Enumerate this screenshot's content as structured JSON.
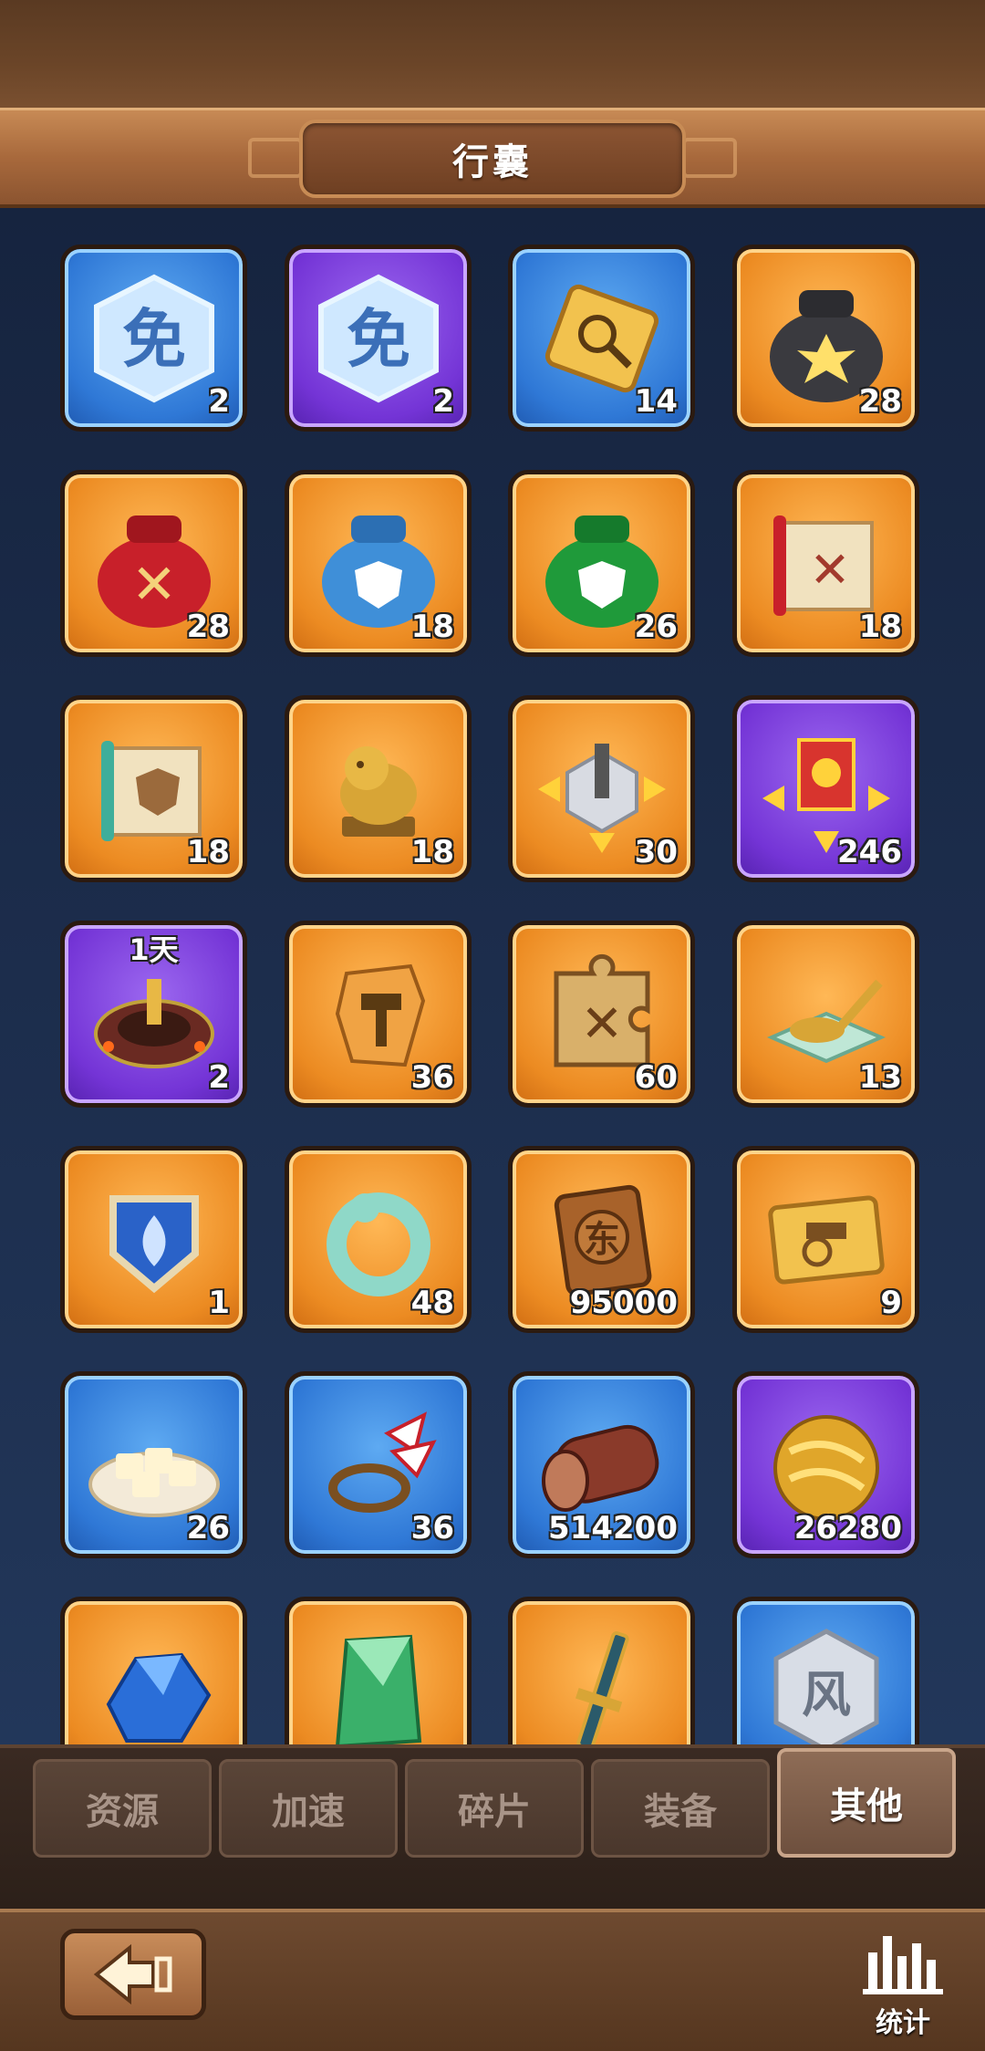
{
  "header": {
    "title": "行囊"
  },
  "items": [
    {
      "icon": "immunity-shield-icon",
      "count": "2",
      "rarity": "blue"
    },
    {
      "icon": "immunity-shield-icon",
      "count": "2",
      "rarity": "purple"
    },
    {
      "icon": "scout-token-icon",
      "count": "14",
      "rarity": "blue"
    },
    {
      "icon": "black-resource-bag-icon",
      "count": "28",
      "rarity": "orange"
    },
    {
      "icon": "red-swords-bag-icon",
      "count": "28",
      "rarity": "orange"
    },
    {
      "icon": "blue-shield-bag-icon",
      "count": "18",
      "rarity": "orange"
    },
    {
      "icon": "green-shield-bag-icon",
      "count": "26",
      "rarity": "orange"
    },
    {
      "icon": "swords-scroll-icon",
      "count": "18",
      "rarity": "orange"
    },
    {
      "icon": "shield-scroll-icon",
      "count": "18",
      "rarity": "orange"
    },
    {
      "icon": "golden-lion-statue-icon",
      "count": "18",
      "rarity": "orange"
    },
    {
      "icon": "city-relocation-icon",
      "count": "30",
      "rarity": "orange"
    },
    {
      "icon": "banner-relocation-icon",
      "count": "246",
      "rarity": "purple"
    },
    {
      "icon": "fortress-skin-icon",
      "count": "2",
      "rarity": "purple",
      "timer": "1天"
    },
    {
      "icon": "hammer-stone-icon",
      "count": "36",
      "rarity": "orange"
    },
    {
      "icon": "puzzle-swords-icon",
      "count": "60",
      "rarity": "orange"
    },
    {
      "icon": "jade-spoon-icon",
      "count": "13",
      "rarity": "orange"
    },
    {
      "icon": "leaf-badge-icon",
      "count": "1",
      "rarity": "orange"
    },
    {
      "icon": "jade-dragon-icon",
      "count": "48",
      "rarity": "orange"
    },
    {
      "icon": "bronze-token-icon",
      "count": "95000",
      "rarity": "orange"
    },
    {
      "icon": "chariot-plaque-icon",
      "count": "9",
      "rarity": "orange"
    },
    {
      "icon": "tofu-plate-icon",
      "count": "26",
      "rarity": "blue"
    },
    {
      "icon": "feather-headdress-icon",
      "count": "36",
      "rarity": "blue"
    },
    {
      "icon": "wood-log-icon",
      "count": "514200",
      "rarity": "blue"
    },
    {
      "icon": "gold-ore-icon",
      "count": "26280",
      "rarity": "purple"
    },
    {
      "icon": "blue-crystal-icon",
      "count": "",
      "rarity": "orange"
    },
    {
      "icon": "green-crystal-icon",
      "count": "",
      "rarity": "orange"
    },
    {
      "icon": "ornate-sword-icon",
      "count": "",
      "rarity": "orange"
    },
    {
      "icon": "silver-plaque-icon",
      "count": "",
      "rarity": "blue"
    }
  ],
  "tabs": [
    {
      "label": "资源",
      "active": false
    },
    {
      "label": "加速",
      "active": false
    },
    {
      "label": "碎片",
      "active": false
    },
    {
      "label": "装备",
      "active": false
    },
    {
      "label": "其他",
      "active": true
    }
  ],
  "footer": {
    "stats_label": "统计"
  }
}
